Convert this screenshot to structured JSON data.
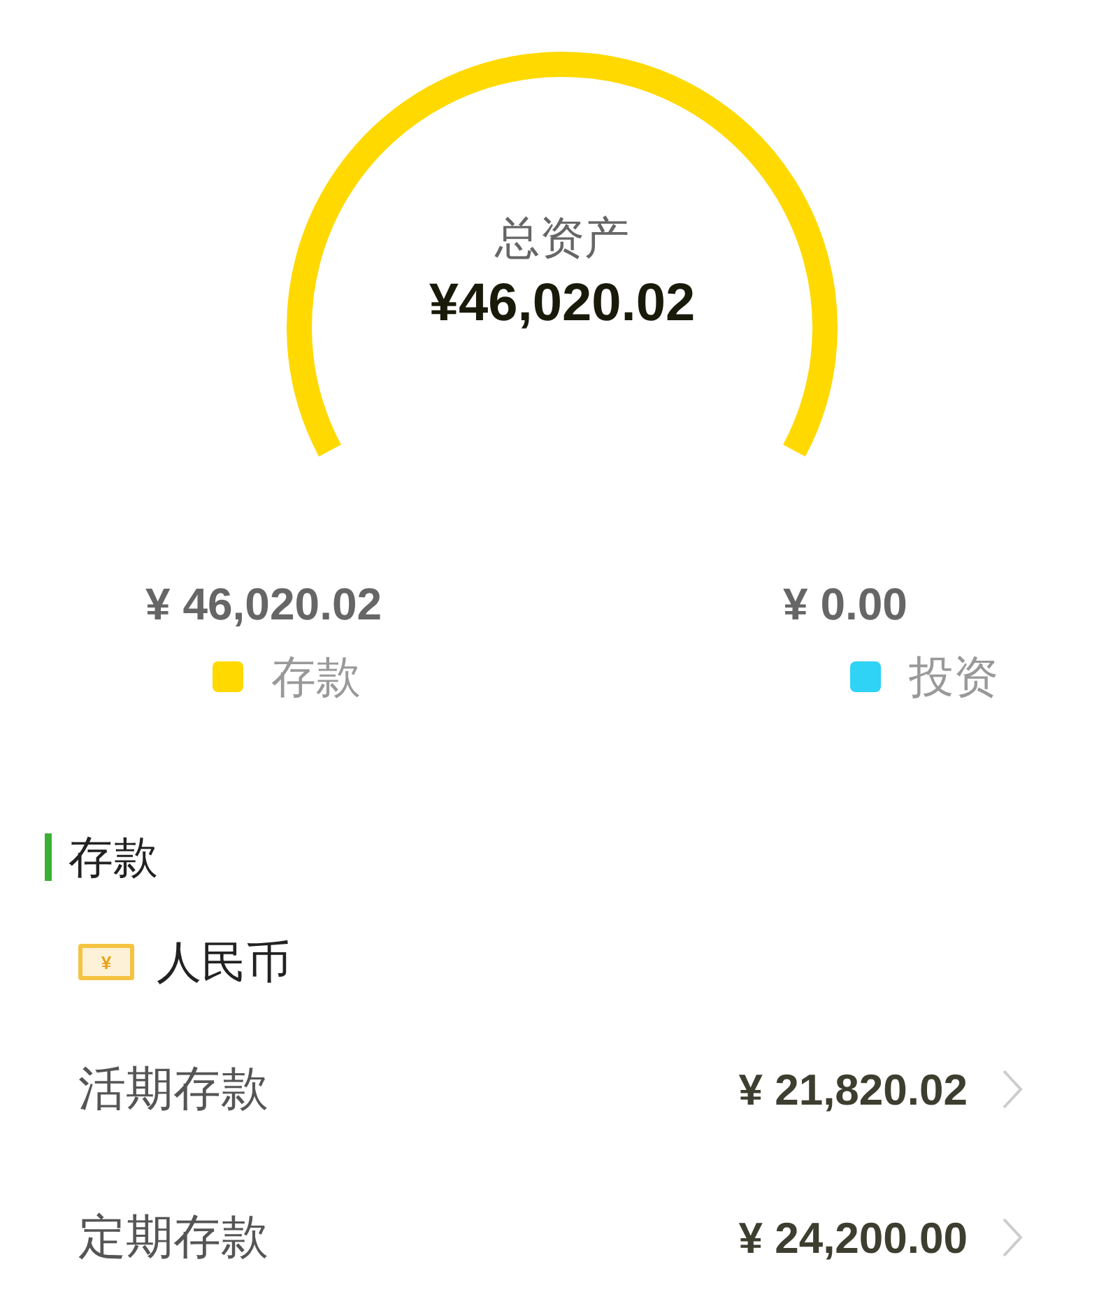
{
  "gauge": {
    "title": "总资产",
    "total": "¥46,020.02"
  },
  "legend": [
    {
      "amount": "¥ 46,020.02",
      "label": "存款",
      "color": "#ffd900"
    },
    {
      "amount": "¥ 0.00",
      "label": "投资",
      "color": "#2ed3f5"
    }
  ],
  "section": {
    "title": "存款",
    "currency": {
      "icon_glyph": "¥",
      "name": "人民币"
    },
    "rows": [
      {
        "label": "活期存款",
        "amount": "¥ 21,820.02"
      },
      {
        "label": "定期存款",
        "amount": "¥ 24,200.00"
      }
    ]
  }
}
